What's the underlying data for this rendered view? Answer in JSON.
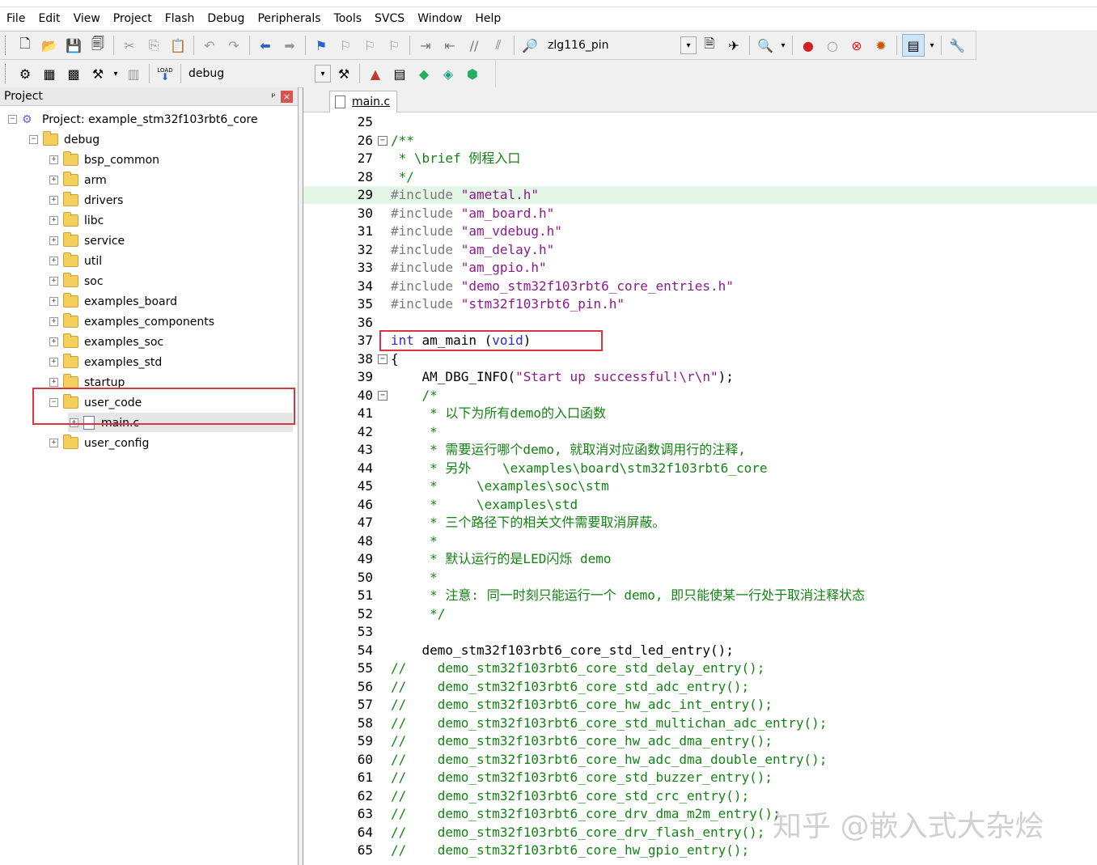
{
  "menu": [
    "File",
    "Edit",
    "View",
    "Project",
    "Flash",
    "Debug",
    "Peripherals",
    "Tools",
    "SVCS",
    "Window",
    "Help"
  ],
  "toolbar1": {
    "target_combo": "zlg116_pin"
  },
  "toolbar2": {
    "build_combo": "debug",
    "load_label": "LOAD"
  },
  "project_panel": {
    "title": "Project",
    "pin_glyph": "ᵖ",
    "close_glyph": "×",
    "root": "Project: example_stm32f103rbt6_core",
    "group": "debug",
    "folders": [
      "bsp_common",
      "arm",
      "drivers",
      "libc",
      "service",
      "util",
      "soc",
      "examples_board",
      "examples_components",
      "examples_soc",
      "examples_std",
      "startup",
      "user_code"
    ],
    "file": "main.c",
    "last_folder": "user_config"
  },
  "editor": {
    "tab": "main.c",
    "lines": [
      {
        "n": "25",
        "fold": "",
        "parts": []
      },
      {
        "n": "26",
        "fold": "−",
        "parts": [
          {
            "c": "c-comment",
            "t": "/**"
          }
        ]
      },
      {
        "n": "27",
        "fold": "",
        "parts": [
          {
            "c": "c-comment",
            "t": " * \\brief 例程入口"
          }
        ]
      },
      {
        "n": "28",
        "fold": "",
        "parts": [
          {
            "c": "c-comment",
            "t": " */"
          }
        ]
      },
      {
        "n": "29",
        "fold": "",
        "hl": true,
        "parts": [
          {
            "c": "c-pre",
            "t": "#include "
          },
          {
            "c": "c-str",
            "t": "\"ametal.h\""
          }
        ]
      },
      {
        "n": "30",
        "fold": "",
        "parts": [
          {
            "c": "c-pre",
            "t": "#include "
          },
          {
            "c": "c-str",
            "t": "\"am_board.h\""
          }
        ]
      },
      {
        "n": "31",
        "fold": "",
        "parts": [
          {
            "c": "c-pre",
            "t": "#include "
          },
          {
            "c": "c-str",
            "t": "\"am_vdebug.h\""
          }
        ]
      },
      {
        "n": "32",
        "fold": "",
        "parts": [
          {
            "c": "c-pre",
            "t": "#include "
          },
          {
            "c": "c-str",
            "t": "\"am_delay.h\""
          }
        ]
      },
      {
        "n": "33",
        "fold": "",
        "parts": [
          {
            "c": "c-pre",
            "t": "#include "
          },
          {
            "c": "c-str",
            "t": "\"am_gpio.h\""
          }
        ]
      },
      {
        "n": "34",
        "fold": "",
        "parts": [
          {
            "c": "c-pre",
            "t": "#include "
          },
          {
            "c": "c-str",
            "t": "\"demo_stm32f103rbt6_core_entries.h\""
          }
        ]
      },
      {
        "n": "35",
        "fold": "",
        "parts": [
          {
            "c": "c-pre",
            "t": "#include "
          },
          {
            "c": "c-str",
            "t": "\"stm32f103rbt6_pin.h\""
          }
        ]
      },
      {
        "n": "36",
        "fold": "",
        "parts": []
      },
      {
        "n": "37",
        "fold": "",
        "parts": [
          {
            "c": "c-kw",
            "t": "int"
          },
          {
            "c": "c-norm",
            "t": " am_main ("
          },
          {
            "c": "c-kw",
            "t": "void"
          },
          {
            "c": "c-norm",
            "t": ")"
          }
        ]
      },
      {
        "n": "38",
        "fold": "−",
        "parts": [
          {
            "c": "c-norm",
            "t": "{"
          }
        ]
      },
      {
        "n": "39",
        "fold": "",
        "parts": [
          {
            "c": "c-norm",
            "t": "    AM_DBG_INFO("
          },
          {
            "c": "c-str",
            "t": "\"Start up successful!\\r\\n\""
          },
          {
            "c": "c-norm",
            "t": ");"
          }
        ]
      },
      {
        "n": "40",
        "fold": "−",
        "parts": [
          {
            "c": "c-comment",
            "t": "    /*"
          }
        ]
      },
      {
        "n": "41",
        "fold": "",
        "parts": [
          {
            "c": "c-comment",
            "t": "     * 以下为所有demo的入口函数"
          }
        ]
      },
      {
        "n": "42",
        "fold": "",
        "parts": [
          {
            "c": "c-comment",
            "t": "     *"
          }
        ]
      },
      {
        "n": "43",
        "fold": "",
        "parts": [
          {
            "c": "c-comment",
            "t": "     * 需要运行哪个demo, 就取消对应函数调用行的注释,"
          }
        ]
      },
      {
        "n": "44",
        "fold": "",
        "parts": [
          {
            "c": "c-comment",
            "t": "     * 另外    \\examples\\board\\stm32f103rbt6_core"
          }
        ]
      },
      {
        "n": "45",
        "fold": "",
        "parts": [
          {
            "c": "c-comment",
            "t": "     *     \\examples\\soc\\stm"
          }
        ]
      },
      {
        "n": "46",
        "fold": "",
        "parts": [
          {
            "c": "c-comment",
            "t": "     *     \\examples\\std"
          }
        ]
      },
      {
        "n": "47",
        "fold": "",
        "parts": [
          {
            "c": "c-comment",
            "t": "     * 三个路径下的相关文件需要取消屏蔽。"
          }
        ]
      },
      {
        "n": "48",
        "fold": "",
        "parts": [
          {
            "c": "c-comment",
            "t": "     *"
          }
        ]
      },
      {
        "n": "49",
        "fold": "",
        "parts": [
          {
            "c": "c-comment",
            "t": "     * 默认运行的是LED闪烁 demo"
          }
        ]
      },
      {
        "n": "50",
        "fold": "",
        "parts": [
          {
            "c": "c-comment",
            "t": "     *"
          }
        ]
      },
      {
        "n": "51",
        "fold": "",
        "parts": [
          {
            "c": "c-comment",
            "t": "     * 注意: 同一时刻只能运行一个 demo, 即只能使某一行处于取消注释状态"
          }
        ]
      },
      {
        "n": "52",
        "fold": "",
        "parts": [
          {
            "c": "c-comment",
            "t": "     */"
          }
        ]
      },
      {
        "n": "53",
        "fold": "",
        "parts": []
      },
      {
        "n": "54",
        "fold": "",
        "parts": [
          {
            "c": "c-norm",
            "t": "    demo_stm32f103rbt6_core_std_led_entry();"
          }
        ]
      },
      {
        "n": "55",
        "fold": "",
        "parts": [
          {
            "c": "c-comment",
            "t": "//    demo_stm32f103rbt6_core_std_delay_entry();"
          }
        ]
      },
      {
        "n": "56",
        "fold": "",
        "parts": [
          {
            "c": "c-comment",
            "t": "//    demo_stm32f103rbt6_core_std_adc_entry();"
          }
        ]
      },
      {
        "n": "57",
        "fold": "",
        "parts": [
          {
            "c": "c-comment",
            "t": "//    demo_stm32f103rbt6_core_hw_adc_int_entry();"
          }
        ]
      },
      {
        "n": "58",
        "fold": "",
        "parts": [
          {
            "c": "c-comment",
            "t": "//    demo_stm32f103rbt6_core_std_multichan_adc_entry();"
          }
        ]
      },
      {
        "n": "59",
        "fold": "",
        "parts": [
          {
            "c": "c-comment",
            "t": "//    demo_stm32f103rbt6_core_hw_adc_dma_entry();"
          }
        ]
      },
      {
        "n": "60",
        "fold": "",
        "parts": [
          {
            "c": "c-comment",
            "t": "//    demo_stm32f103rbt6_core_hw_adc_dma_double_entry();"
          }
        ]
      },
      {
        "n": "61",
        "fold": "",
        "parts": [
          {
            "c": "c-comment",
            "t": "//    demo_stm32f103rbt6_core_std_buzzer_entry();"
          }
        ]
      },
      {
        "n": "62",
        "fold": "",
        "parts": [
          {
            "c": "c-comment",
            "t": "//    demo_stm32f103rbt6_core_std_crc_entry();"
          }
        ]
      },
      {
        "n": "63",
        "fold": "",
        "parts": [
          {
            "c": "c-comment",
            "t": "//    demo_stm32f103rbt6_core_drv_dma_m2m_entry();"
          }
        ]
      },
      {
        "n": "64",
        "fold": "",
        "parts": [
          {
            "c": "c-comment",
            "t": "//    demo_stm32f103rbt6_core_drv_flash_entry();"
          }
        ]
      },
      {
        "n": "65",
        "fold": "",
        "parts": [
          {
            "c": "c-comment",
            "t": "//    demo_stm32f103rbt6_core_hw_gpio_entry();"
          }
        ]
      }
    ]
  },
  "watermark": "知乎 @嵌入式大杂烩"
}
